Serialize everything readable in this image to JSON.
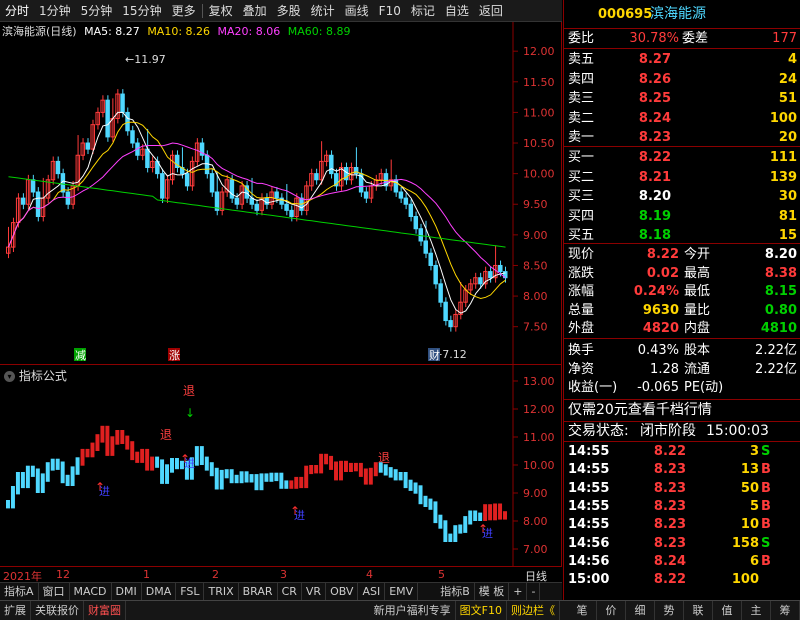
{
  "toolbar": [
    "分时",
    "1分钟",
    "5分钟",
    "15分钟",
    "更多",
    "复权",
    "叠加",
    "多股",
    "统计",
    "画线",
    "F10",
    "标记",
    "自选",
    "返回"
  ],
  "stock": {
    "code": "000695",
    "name": "滨海能源"
  },
  "legend": {
    "title": "滨海能源(日线)",
    "ma5": "MA5: 8.27",
    "ma10": "MA10: 8.26",
    "ma20": "MA20: 8.06",
    "ma60": "MA60: 8.89"
  },
  "price_axis": [
    "12.00",
    "11.50",
    "11.00",
    "10.50",
    "10.00",
    "9.50",
    "9.00",
    "8.50",
    "8.00",
    "7.50"
  ],
  "ind_axis": [
    "13.00",
    "12.00",
    "11.00",
    "10.00",
    "9.00",
    "8.00",
    "7.00"
  ],
  "annotations": {
    "high": "11.97",
    "low": "7.12",
    "jian": "减",
    "zhang": "涨",
    "cai": "财",
    "tui": "退",
    "jin": "进"
  },
  "indicator_title": "指标公式",
  "timeline": {
    "year": "2021年",
    "m12": "12",
    "m1": "1",
    "m2": "2",
    "m3": "3",
    "m4": "4",
    "m5": "5",
    "period": "日线"
  },
  "ind_tabs": [
    "指标A",
    "窗口",
    "MACD",
    "DMI",
    "DMA",
    "FSL",
    "TRIX",
    "BRAR",
    "CR",
    "VR",
    "OBV",
    "ASI",
    "EMV",
    "指标B",
    "模 板",
    "+",
    "-"
  ],
  "bottom": [
    "扩展",
    "关联报价",
    "财富圈",
    "新用户福利专享",
    "图文F10",
    "则边栏《",
    "笔",
    "价",
    "细",
    "势",
    "联",
    "值",
    "主",
    "筹"
  ],
  "panel": {
    "weibi_label": "委比",
    "weibi": "30.78%",
    "weicha_label": "委差",
    "weicha": "177",
    "sell": [
      {
        "label": "卖五",
        "price": "8.27",
        "vol": "4"
      },
      {
        "label": "卖四",
        "price": "8.26",
        "vol": "24"
      },
      {
        "label": "卖三",
        "price": "8.25",
        "vol": "51"
      },
      {
        "label": "卖二",
        "price": "8.24",
        "vol": "100"
      },
      {
        "label": "卖一",
        "price": "8.23",
        "vol": "20"
      }
    ],
    "buy": [
      {
        "label": "买一",
        "price": "8.22",
        "vol": "111",
        "c": "red"
      },
      {
        "label": "买二",
        "price": "8.21",
        "vol": "139",
        "c": "red"
      },
      {
        "label": "买三",
        "price": "8.20",
        "vol": "30",
        "c": "white"
      },
      {
        "label": "买四",
        "price": "8.19",
        "vol": "81",
        "c": "green"
      },
      {
        "label": "买五",
        "price": "8.18",
        "vol": "15",
        "c": "green"
      }
    ],
    "stats": [
      {
        "l1": "现价",
        "v1": "8.22",
        "c1": "red",
        "l2": "今开",
        "v2": "8.20",
        "c2": "white"
      },
      {
        "l1": "涨跌",
        "v1": "0.02",
        "c1": "red",
        "l2": "最高",
        "v2": "8.38",
        "c2": "red"
      },
      {
        "l1": "涨幅",
        "v1": "0.24%",
        "c1": "red",
        "l2": "最低",
        "v2": "8.15",
        "c2": "green"
      },
      {
        "l1": "总量",
        "v1": "9630",
        "c1": "yellow",
        "l2": "量比",
        "v2": "0.80",
        "c2": "green"
      },
      {
        "l1": "外盘",
        "v1": "4820",
        "c1": "red",
        "l2": "内盘",
        "v2": "4810",
        "c2": "green"
      }
    ],
    "info": [
      {
        "l1": "换手",
        "v1": "0.43%",
        "l2": "股本",
        "v2": "2.22亿"
      },
      {
        "l1": "净资",
        "v1": "1.28",
        "l2": "流通",
        "v2": "2.22亿"
      },
      {
        "l1": "收益(一)",
        "v1": "-0.065",
        "l2": "PE(动)",
        "v2": ""
      }
    ],
    "promo": "仅需20元查看千档行情",
    "status_label": "交易状态:",
    "status": "闭市阶段",
    "status_time": "15:00:03",
    "ticks": [
      {
        "t": "14:55",
        "p": "8.22",
        "v": "3",
        "s": "S",
        "pc": "red"
      },
      {
        "t": "14:55",
        "p": "8.23",
        "v": "13",
        "s": "B",
        "pc": "red"
      },
      {
        "t": "14:55",
        "p": "8.23",
        "v": "50",
        "s": "B",
        "pc": "red"
      },
      {
        "t": "14:55",
        "p": "8.23",
        "v": "5",
        "s": "B",
        "pc": "red"
      },
      {
        "t": "14:55",
        "p": "8.23",
        "v": "10",
        "s": "B",
        "pc": "red"
      },
      {
        "t": "14:56",
        "p": "8.23",
        "v": "158",
        "s": "S",
        "pc": "red"
      },
      {
        "t": "14:56",
        "p": "8.24",
        "v": "6",
        "s": "B",
        "pc": "red"
      },
      {
        "t": "15:00",
        "p": "8.22",
        "v": "100",
        "s": "",
        "pc": "red"
      }
    ]
  },
  "colors": {
    "up": "#ff3b3b",
    "down": "#4fd8ff",
    "ma5": "#ffffff",
    "ma10": "#ffd700",
    "ma20": "#ff40ff",
    "ma60": "#00d000"
  }
}
